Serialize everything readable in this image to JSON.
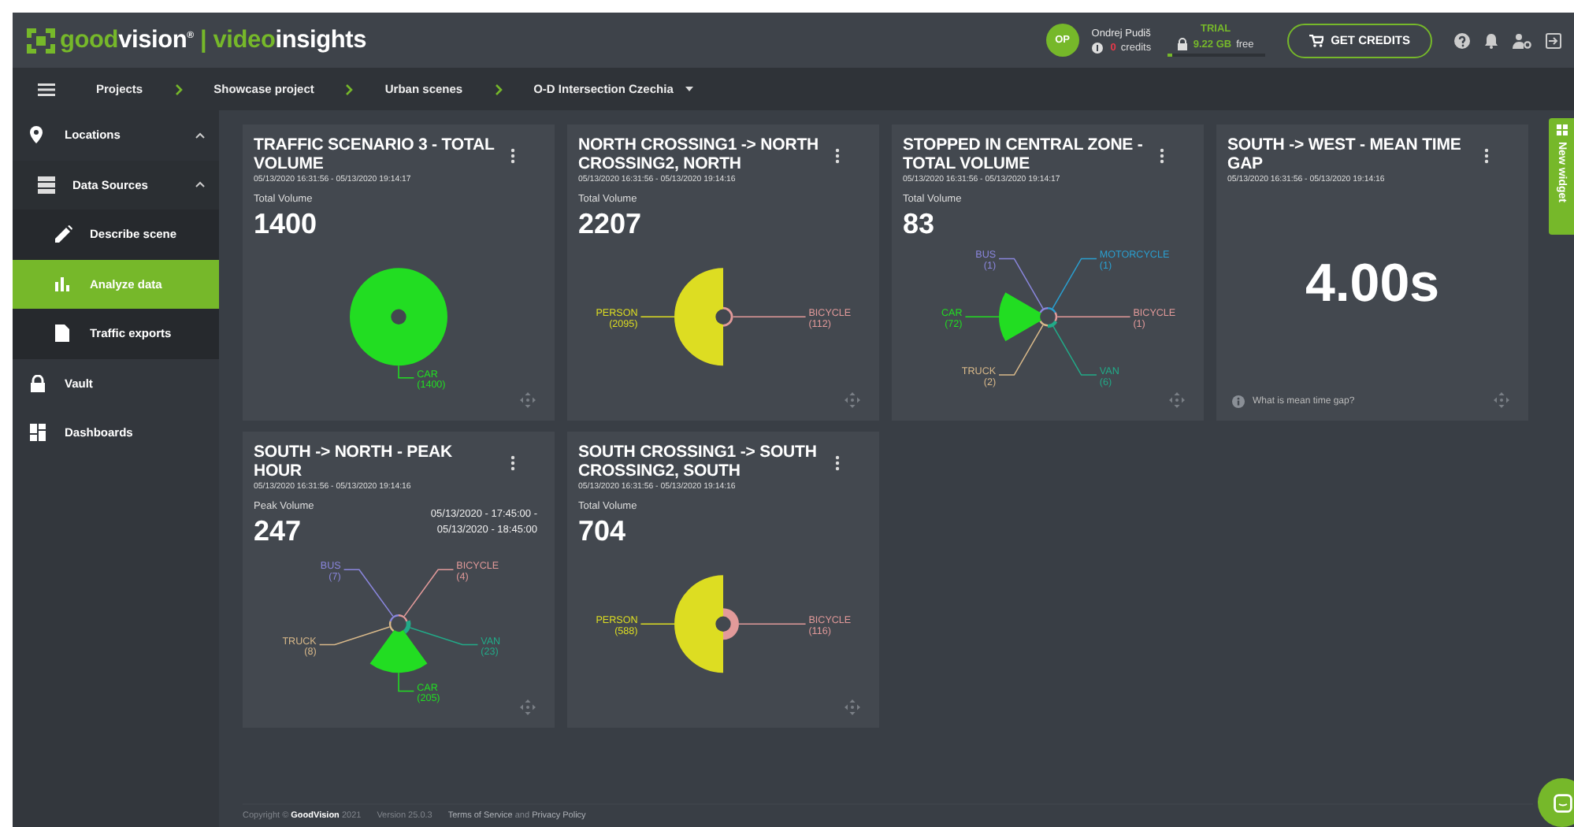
{
  "header": {
    "brand": [
      {
        "text": "good",
        "accent": true
      },
      {
        "text": "vision$^{®}$",
        "accent": false
      },
      {
        "text": " | ",
        "accent": true
      },
      {
        "text": "video",
        "accent": true
      },
      {
        "text": "insights",
        "accent": false
      }
    ],
    "user": {
      "initials": "OP",
      "name": "Ondrej Pudiš",
      "credits": "0",
      "credits_label": "credits",
      "plan": "TRIAL",
      "storage": "9.22 GB",
      "storage_label": "free",
      "storage_bar": {
        "level": 0.06
      }
    },
    "action": "GET CREDITS"
  },
  "breadcrumbs": [
    {
      "label": "Projects",
      "dropdown": false
    },
    {
      "label": "Showcase project",
      "dropdown": false
    },
    {
      "label": "Urban scenes",
      "dropdown": false
    },
    {
      "label": "O-D Intersection Czechia",
      "dropdown": true
    }
  ],
  "sidebar": {
    "items": [
      {
        "label": "Locations",
        "selected": false,
        "expanded": true,
        "children": [
          {
            "label": "Data Sources",
            "selected": false,
            "expanded": true,
            "children": [
              {
                "label": "Describe scene",
                "selected": false
              },
              {
                "label": "Analyze data",
                "selected": true
              },
              {
                "label": "Traffic exports",
                "selected": false
              }
            ]
          }
        ]
      },
      {
        "label": "Vault",
        "selected": false
      },
      {
        "label": "Dashboards",
        "selected": false
      }
    ]
  },
  "new_widget": "New widget",
  "cards": [
    {
      "kind": "volume",
      "title": "TRAFFIC SCENARIO 3 - TOTAL VOLUME",
      "dates": "05/13/2020 16:31:56 - 05/13/2020 19:14:17",
      "metric_label": "Total Volume",
      "metric": "1400",
      "segments": [
        {
          "label": "CAR",
          "count": "(1400)",
          "color": "#22dd22"
        }
      ]
    },
    {
      "kind": "volume",
      "title": "NORTH CROSSING1 -> NORTH CROSSING2, NORTH",
      "dates": "05/13/2020 16:31:56 - 05/13/2020 19:14:16",
      "metric_label": "Total Volume",
      "metric": "2207",
      "segments": [
        {
          "label": "PERSON",
          "count": "(2095)",
          "color": "#dddd22"
        },
        {
          "label": "BICYCLE",
          "count": "(112)",
          "color": "#e29a9a"
        }
      ]
    },
    {
      "kind": "volume",
      "title": "STOPPED IN CENTRAL ZONE - TOTAL VOLUME",
      "dates": "05/13/2020 16:31:56 - 05/13/2020 19:14:17",
      "metric_label": "Total Volume",
      "metric": "83",
      "segments": [
        {
          "label": "MOTORCYCLE",
          "count": "(1)",
          "color": "#2a9fd0"
        },
        {
          "label": "BICYCLE",
          "count": "(1)",
          "color": "#e29a9a"
        },
        {
          "label": "VAN",
          "count": "(6)",
          "color": "#22aa88"
        },
        {
          "label": "TRUCK",
          "count": "(2)",
          "color": "#d9b98a"
        },
        {
          "label": "CAR",
          "count": "(72)",
          "color": "#22dd22"
        },
        {
          "label": "BUS",
          "count": "(1)",
          "color": "#8a86dd"
        }
      ]
    },
    {
      "kind": "time_gap",
      "title": "SOUTH -> WEST - MEAN TIME GAP",
      "dates": "05/13/2020 16:31:56 - 05/13/2020 19:14:16",
      "metric": "4.00s",
      "help": "What is mean time gap?"
    },
    {
      "kind": "volume",
      "title": "SOUTH -> NORTH - PEAK HOUR",
      "dates": "05/13/2020 16:31:56 - 05/13/2020 19:14:16",
      "metric_label": "Peak Volume",
      "metric": "247",
      "peak_range": [
        "05/13/2020 - 17:45:00 -",
        "05/13/2020 - 18:45:00"
      ],
      "segments": [
        {
          "label": "BICYCLE",
          "count": "(4)",
          "color": "#e29a9a"
        },
        {
          "label": "VAN",
          "count": "(23)",
          "color": "#22aa88"
        },
        {
          "label": "CAR",
          "count": "(205)",
          "color": "#22dd22"
        },
        {
          "label": "TRUCK",
          "count": "(8)",
          "color": "#d9b98a"
        },
        {
          "label": "BUS",
          "count": "(7)",
          "color": "#8a86dd"
        }
      ]
    },
    {
      "kind": "volume",
      "title": "SOUTH CROSSING1 -> SOUTH CROSSING2, SOUTH",
      "dates": "05/13/2020 16:31:56 - 05/13/2020 19:14:16",
      "metric_label": "Total Volume",
      "metric": "704",
      "segments": [
        {
          "label": "PERSON",
          "count": "(588)",
          "color": "#dddd22"
        },
        {
          "label": "BICYCLE",
          "count": "(116)",
          "color": "#e29a9a"
        }
      ]
    }
  ],
  "footer": {
    "copyright": "Copyright © **GoodVision** 2021",
    "version": "Version 25.0.3",
    "links": [
      "Terms of Service",
      "Privacy Policy"
    ],
    "joiner": "and"
  }
}
